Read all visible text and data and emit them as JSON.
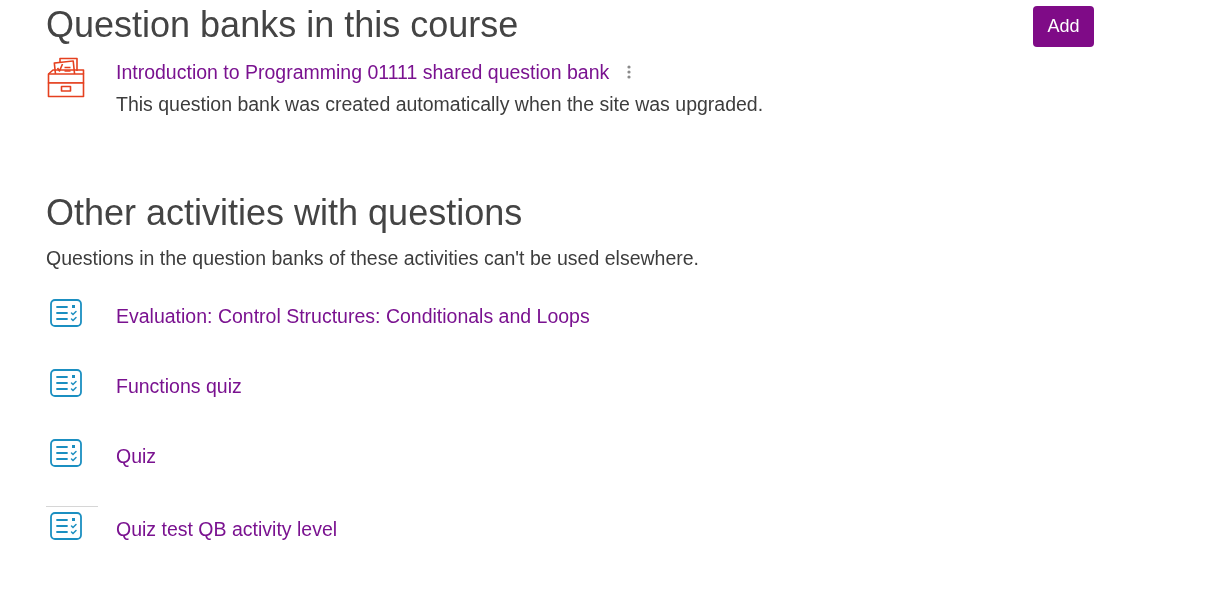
{
  "course_banks": {
    "heading": "Question banks in this course",
    "add_button": "Add",
    "banks": [
      {
        "title": "Introduction to Programming 01111 shared question bank",
        "description": "This question bank was created automatically when the site was upgraded."
      }
    ]
  },
  "other_activities": {
    "heading": "Other activities with questions",
    "description": "Questions in the question banks of these activities can't be used elsewhere.",
    "activities": [
      {
        "title": "Evaluation: Control Structures: Conditionals and Loops",
        "divider_above": false
      },
      {
        "title": "Functions quiz",
        "divider_above": false
      },
      {
        "title": "Quiz",
        "divider_above": false
      },
      {
        "title": "Quiz test QB activity level",
        "divider_above": true
      }
    ]
  }
}
